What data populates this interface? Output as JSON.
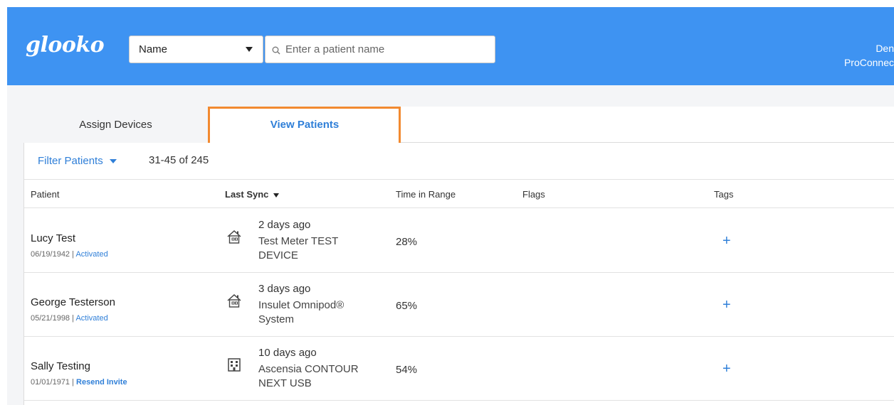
{
  "header": {
    "logo": "glooko",
    "search_type": {
      "selected": "Name"
    },
    "search_input": {
      "placeholder": "Enter a patient name",
      "value": ""
    },
    "user": {
      "name": "Den",
      "org": "ProConnec"
    }
  },
  "tabs": [
    {
      "label": "Assign Devices",
      "active": false
    },
    {
      "label": "View Patients",
      "active": true
    }
  ],
  "filter": {
    "label": "Filter Patients",
    "count_text": "31-45 of 245"
  },
  "columns": {
    "patient": "Patient",
    "last_sync": "Last Sync",
    "time_in_range": "Time in Range",
    "flags": "Flags",
    "tags": "Tags"
  },
  "patients": [
    {
      "name": "Lucy Test",
      "dob": "06/19/1942",
      "separator": " | ",
      "status": "Activated",
      "sync_icon": "home-icon",
      "sync_time": "2 days ago",
      "device": "Test Meter TEST DEVICE",
      "time_in_range": "28%",
      "tag_add": "+"
    },
    {
      "name": "George Testerson",
      "dob": "05/21/1998",
      "separator": " | ",
      "status": "Activated",
      "sync_icon": "home-icon",
      "sync_time": "3 days ago",
      "device": "Insulet Omnipod® System",
      "time_in_range": "65%",
      "tag_add": "+"
    },
    {
      "name": "Sally Testing",
      "dob": "01/01/1971",
      "separator": " | ",
      "status": "Resend Invite",
      "sync_icon": "clinic-building-icon",
      "sync_time": "10 days ago",
      "device": "Ascensia CONTOUR NEXT USB",
      "time_in_range": "54%",
      "tag_add": "+"
    }
  ],
  "colors": {
    "header_bg": "#3e93f2",
    "link": "#2f7fd8",
    "highlight": "#f28a30"
  }
}
